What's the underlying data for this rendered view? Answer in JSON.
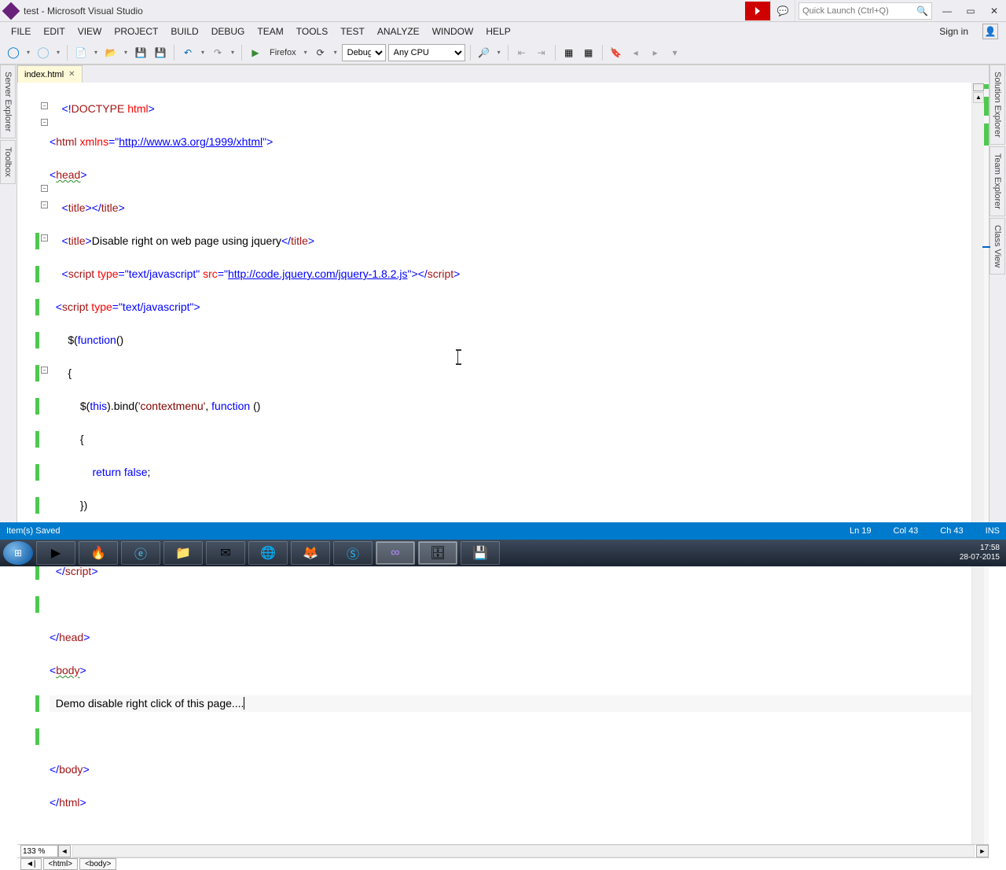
{
  "title": "test - Microsoft Visual Studio",
  "quicklaunch_placeholder": "Quick Launch (Ctrl+Q)",
  "menu": [
    "FILE",
    "EDIT",
    "VIEW",
    "PROJECT",
    "BUILD",
    "DEBUG",
    "TEAM",
    "TOOLS",
    "TEST",
    "ANALYZE",
    "WINDOW",
    "HELP"
  ],
  "signin": "Sign in",
  "toolbar": {
    "browser": "Firefox",
    "config": "Debug",
    "platform": "Any CPU"
  },
  "left_panels": [
    "Server Explorer",
    "Toolbox"
  ],
  "right_panels": [
    "Solution Explorer",
    "Team Explorer",
    "Class View"
  ],
  "file_tab": "index.html",
  "code": {
    "l1_a": "    <!",
    "l1_b": "DOCTYPE",
    "l1_c": " html",
    "l1_d": ">",
    "l2_a": "<",
    "l2_b": "html",
    "l2_c": " xmlns",
    "l2_d": "=\"",
    "l2_link": "http://www.w3.org/1999/xhtml",
    "l2_e": "\">",
    "l3_a": "<",
    "l3_b": "head",
    "l3_c": ">",
    "l4_a": "    <",
    "l4_b": "title",
    "l4_c": "></",
    "l4_d": "title",
    "l4_e": ">",
    "l5_a": "    <",
    "l5_b": "title",
    "l5_c": ">",
    "l5_text": "Disable right on web page using jquery",
    "l5_d": "</",
    "l5_e": "title",
    "l5_f": ">",
    "l6_a": "    <",
    "l6_b": "script",
    "l6_c": " type",
    "l6_d": "=\"text/javascript\"",
    "l6_e": " src",
    "l6_f": "=\"",
    "l6_link": "http://code.jquery.com/jquery-1.8.2.js",
    "l6_g": "\"></",
    "l6_h": "script",
    "l6_i": ">",
    "l7_a": "  <",
    "l7_b": "script",
    "l7_c": " type",
    "l7_d": "=\"text/javascript\"",
    "l7_e": ">",
    "l8": "      $(",
    "l8_b": "function",
    "l8_c": "()",
    "l9": "      {",
    "l10_a": "          $(",
    "l10_b": "this",
    "l10_c": ").bind(",
    "l10_d": "'contextmenu'",
    "l10_e": ", ",
    "l10_f": "function",
    "l10_g": " ()",
    "l11": "          {",
    "l12_a": "              return",
    "l12_b": " false",
    "l12_c": ";",
    "l13": "          })",
    "l14": "      })",
    "l15_a": "  </",
    "l15_b": "script",
    "l15_c": ">",
    "l17_a": "</",
    "l17_b": "head",
    "l17_c": ">",
    "l18_a": "<",
    "l18_b": "body",
    "l18_c": ">",
    "l19": "  Demo disable right click of this page....",
    "l21_a": "</",
    "l21_b": "body",
    "l21_c": ">",
    "l22_a": "</",
    "l22_b": "html",
    "l22_c": ">"
  },
  "zoom": "133 %",
  "breadcrumb": {
    "nav": "◄|",
    "b1": "<html>",
    "b2": "<body>"
  },
  "status": {
    "left": "Item(s) Saved",
    "ln": "Ln 19",
    "col": "Col 43",
    "ch": "Ch 43",
    "ins": "INS"
  },
  "taskbar": {
    "time": "17:58",
    "date": "28-07-2015"
  }
}
